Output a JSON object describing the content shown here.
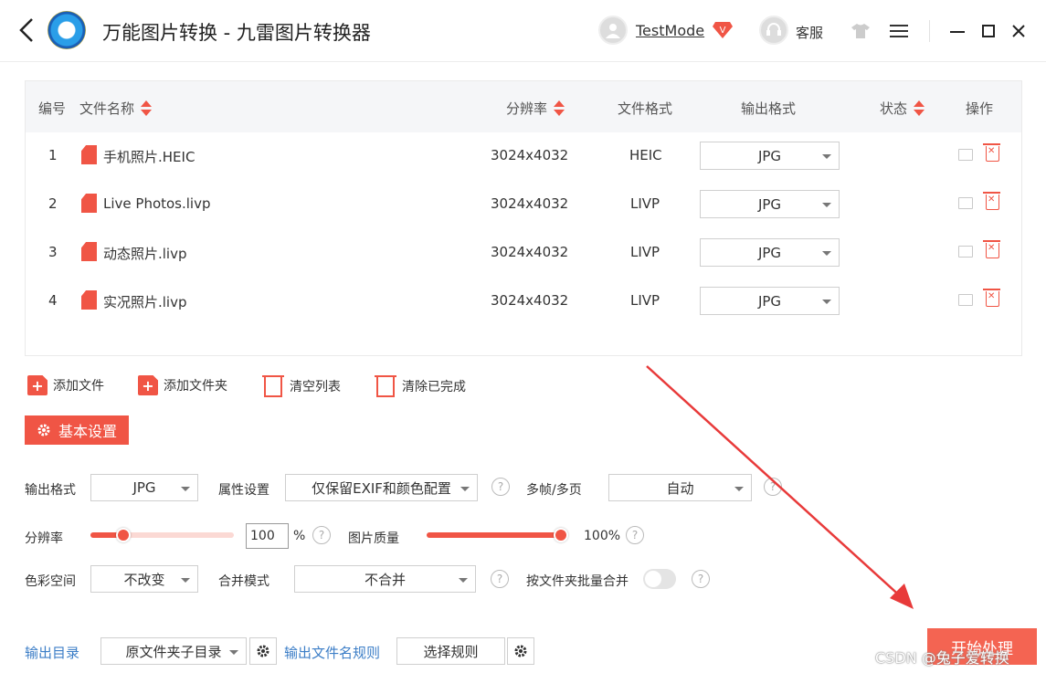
{
  "app": {
    "title": "万能图片转换 - 九雷图片转换器"
  },
  "header": {
    "username": "TestMode",
    "vip": "V",
    "service_label": "客服"
  },
  "table": {
    "headers": {
      "index": "编号",
      "filename": "文件名称",
      "resolution": "分辨率",
      "format": "文件格式",
      "output_format": "输出格式",
      "status": "状态",
      "actions": "操作"
    },
    "rows": [
      {
        "index": "1",
        "name": "手机照片.HEIC",
        "resolution": "3024x4032",
        "format": "HEIC",
        "output": "JPG"
      },
      {
        "index": "2",
        "name": "Live Photos.livp",
        "resolution": "3024x4032",
        "format": "LIVP",
        "output": "JPG"
      },
      {
        "index": "3",
        "name": "动态照片.livp",
        "resolution": "3024x4032",
        "format": "LIVP",
        "output": "JPG"
      },
      {
        "index": "4",
        "name": "实况照片.livp",
        "resolution": "3024x4032",
        "format": "LIVP",
        "output": "JPG"
      }
    ]
  },
  "toolbar": {
    "add_file": "添加文件",
    "add_folder": "添加文件夹",
    "clear_list": "清空列表",
    "clear_done": "清除已完成"
  },
  "settings": {
    "title": "基本设置",
    "output_format_label": "输出格式",
    "output_format_value": "JPG",
    "attr_label": "属性设置",
    "attr_value": "仅保留EXIF和颜色配置",
    "multiframe_label": "多帧/多页",
    "multiframe_value": "自动",
    "resolution_label": "分辨率",
    "resolution_value": "100",
    "resolution_unit": "%",
    "resolution_slider_fraction": 0.2,
    "quality_label": "图片质量",
    "quality_value": "100%",
    "quality_fraction": 1.0,
    "colorspace_label": "色彩空间",
    "colorspace_value": "不改变",
    "merge_label": "合并模式",
    "merge_value": "不合并",
    "folder_merge_label": "按文件夹批量合并",
    "folder_merge_on": false
  },
  "output": {
    "dir_label": "输出目录",
    "dir_value": "原文件夹子目录",
    "rule_label": "输出文件名规则",
    "rule_button": "选择规则"
  },
  "start_button": "开始处理",
  "watermark": "CSDN @兔子爱转换",
  "colors": {
    "accent": "#f05545",
    "link": "#3c7ec7"
  }
}
